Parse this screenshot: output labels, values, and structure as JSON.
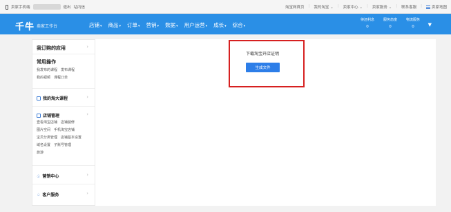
{
  "topbar": {
    "seller_phone": "卖家手机端",
    "logout": "退出",
    "inbox": "站内信",
    "right_links": [
      "淘宝网首页",
      "我的淘宝",
      "卖家中心",
      "卖家服务",
      "联系客服",
      "卖家地图"
    ]
  },
  "header": {
    "logo": "千牛",
    "subtitle": "卖家工作台",
    "nav": [
      "店铺",
      "商品",
      "订单",
      "营销",
      "数据",
      "用户运营",
      "成长",
      "综合"
    ],
    "stats": [
      {
        "label": "待还利息",
        "value": "0"
      },
      {
        "label": "服务态度",
        "value": "0"
      },
      {
        "label": "物流服务",
        "value": "0"
      }
    ]
  },
  "sidebar": {
    "my_apps": "我订购的应用",
    "common_ops": {
      "title": "常用操作",
      "rows": [
        [
          "我发布的课程",
          "发布课程"
        ],
        [
          "我的视频",
          "课程订单"
        ]
      ]
    },
    "taobao_university": "我的淘大课程",
    "shop_management": {
      "title": "店铺管理",
      "rows": [
        [
          "查看淘宝店铺",
          "店铺装修"
        ],
        [
          "图片空间",
          "手机淘宝店铺"
        ],
        [
          "宝贝分类管理",
          "店铺基本设置"
        ],
        [
          "域名设置",
          "子账号管理"
        ],
        [
          "旅游"
        ]
      ]
    },
    "marketing_center": "营销中心",
    "customer_service": "客户服务"
  },
  "main": {
    "download_title": "下载淘宝开店证明",
    "generate_button": "生成文件"
  }
}
